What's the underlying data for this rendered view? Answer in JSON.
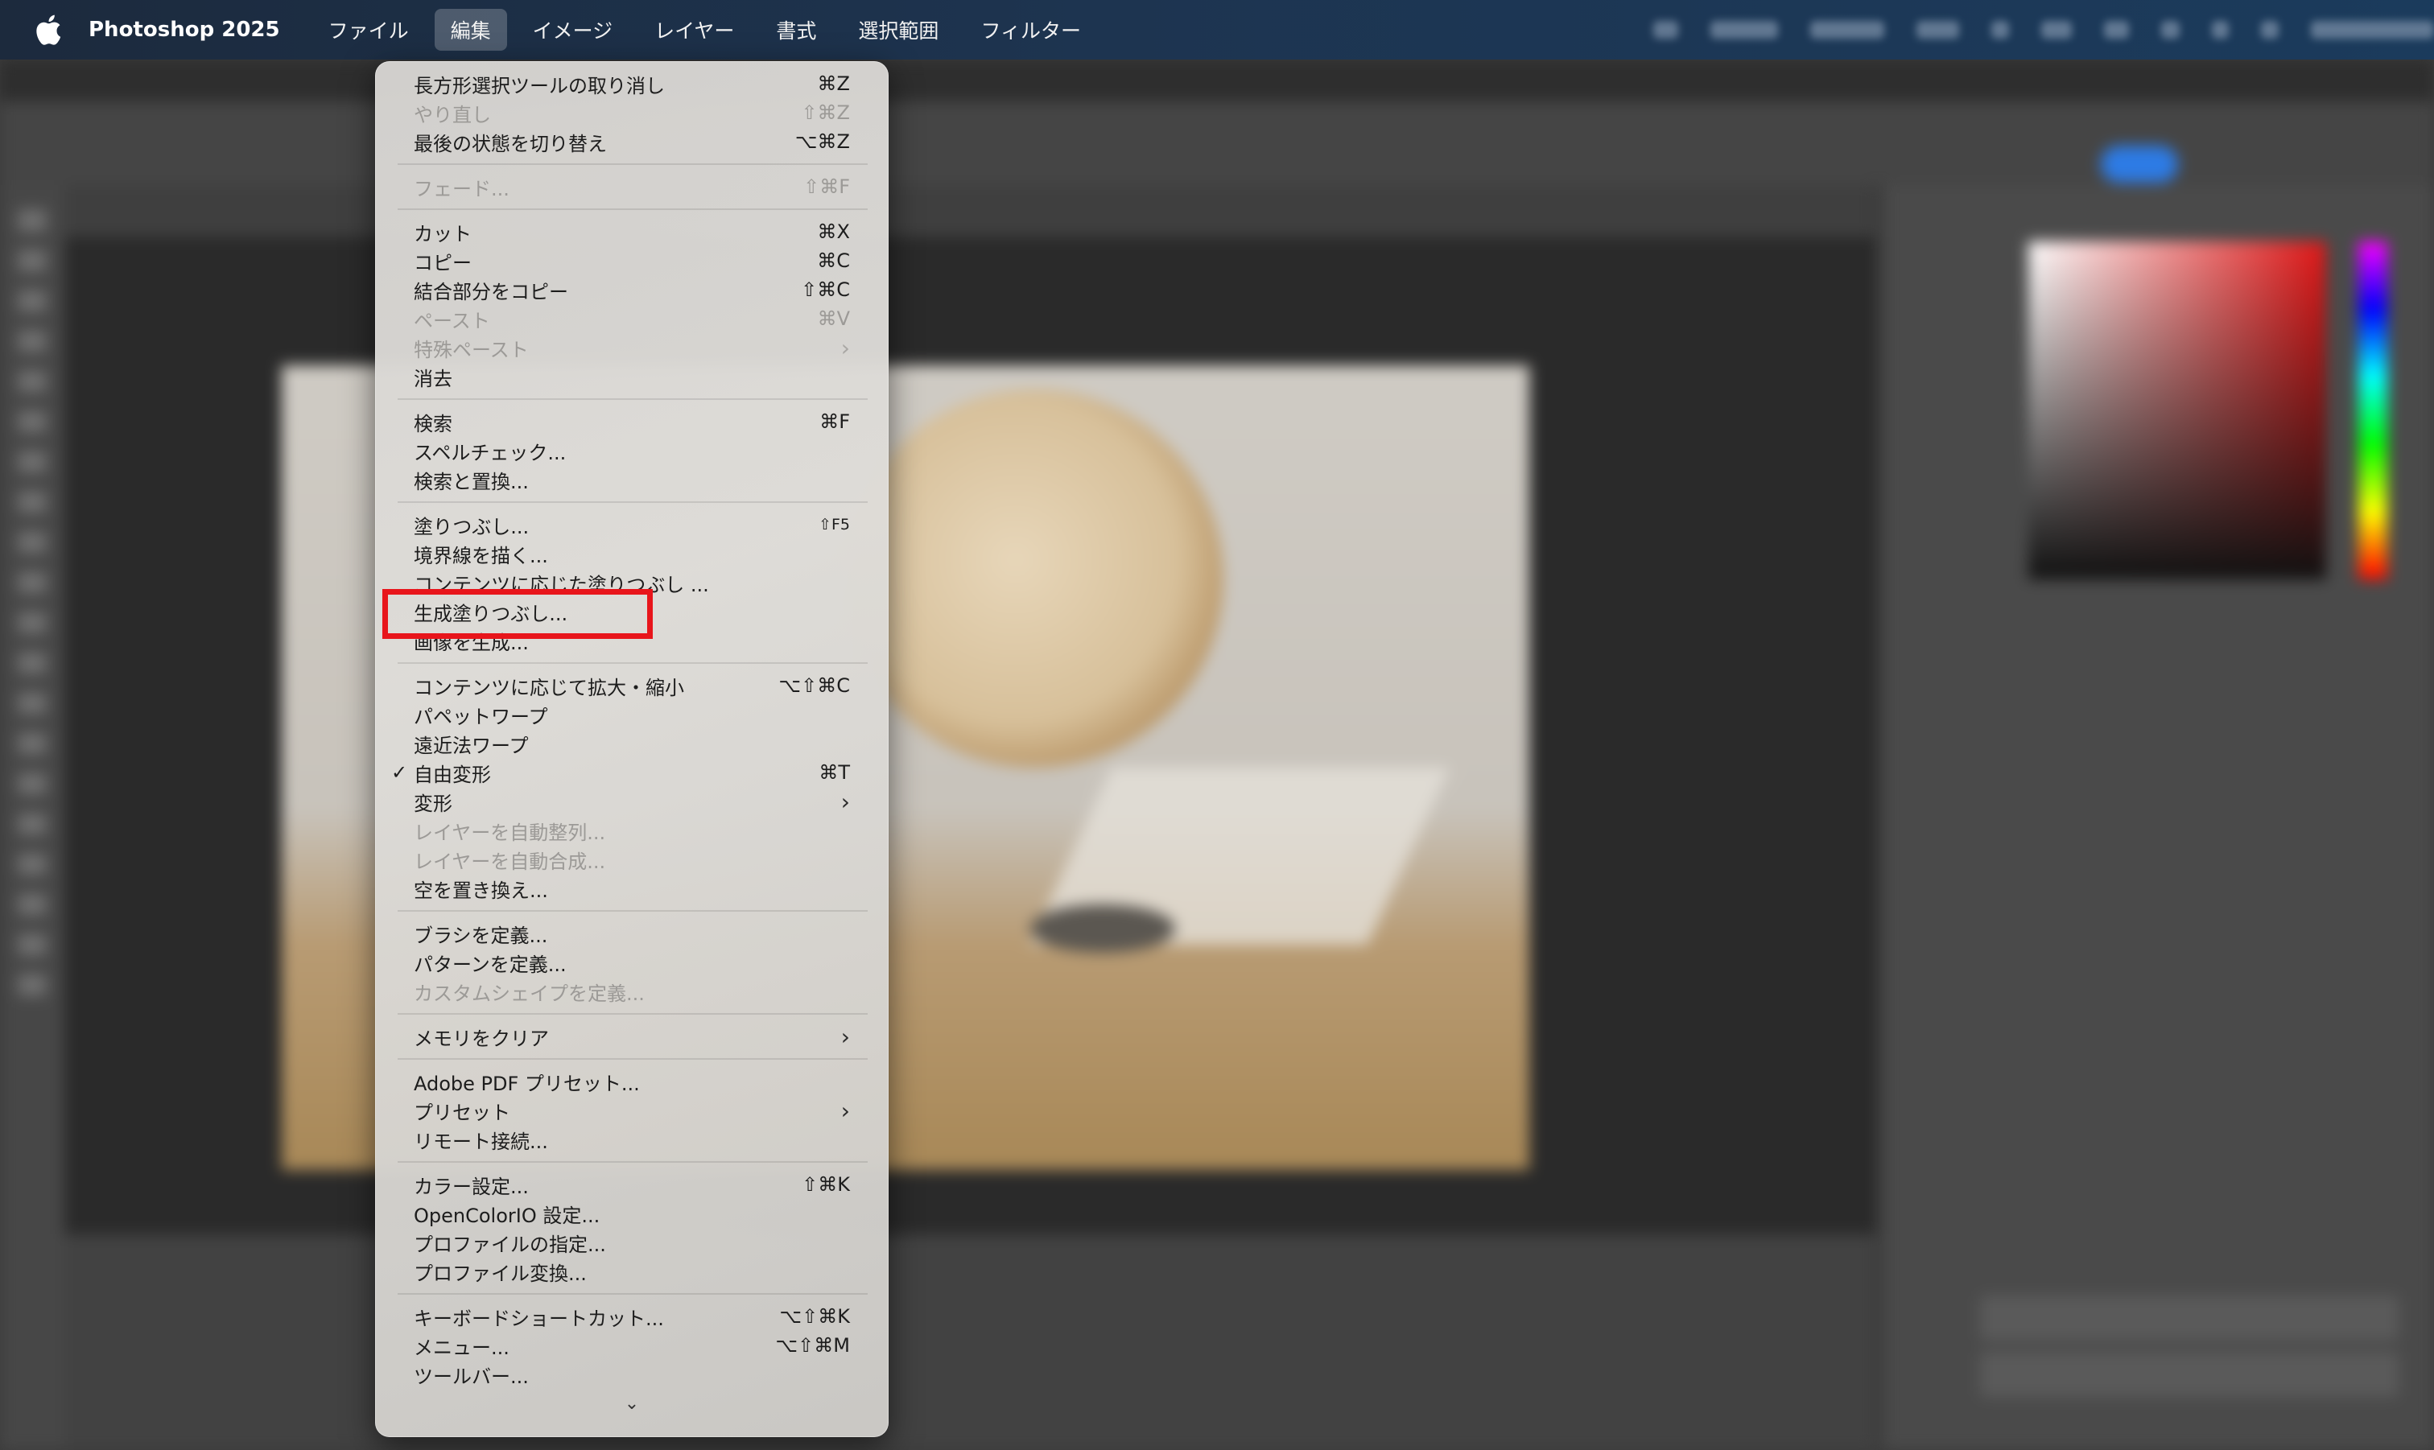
{
  "menubar": {
    "app_name": "Photoshop 2025",
    "menus": [
      {
        "label": "ファイル",
        "active": false
      },
      {
        "label": "編集",
        "active": true
      },
      {
        "label": "イメージ",
        "active": false
      },
      {
        "label": "レイヤー",
        "active": false
      },
      {
        "label": "書式",
        "active": false
      },
      {
        "label": "選択範囲",
        "active": false
      },
      {
        "label": "フィルター",
        "active": false
      }
    ]
  },
  "edit_menu": {
    "groups": [
      [
        {
          "label": "長方形選択ツールの取り消し",
          "shortcut": "⌘Z",
          "disabled": false
        },
        {
          "label": "やり直し",
          "shortcut": "⇧⌘Z",
          "disabled": true
        },
        {
          "label": "最後の状態を切り替え",
          "shortcut": "⌥⌘Z",
          "disabled": false
        }
      ],
      [
        {
          "label": "フェード...",
          "shortcut": "⇧⌘F",
          "disabled": true
        }
      ],
      [
        {
          "label": "カット",
          "shortcut": "⌘X",
          "disabled": false
        },
        {
          "label": "コピー",
          "shortcut": "⌘C",
          "disabled": false
        },
        {
          "label": "結合部分をコピー",
          "shortcut": "⇧⌘C",
          "disabled": false
        },
        {
          "label": "ペースト",
          "shortcut": "⌘V",
          "disabled": true
        },
        {
          "label": "特殊ペースト",
          "shortcut": "",
          "submenu": true,
          "disabled": true
        },
        {
          "label": "消去",
          "shortcut": "",
          "disabled": false
        }
      ],
      [
        {
          "label": "検索",
          "shortcut": "⌘F",
          "disabled": false
        },
        {
          "label": "スペルチェック...",
          "shortcut": "",
          "disabled": false
        },
        {
          "label": "検索と置換...",
          "shortcut": "",
          "disabled": false
        }
      ],
      [
        {
          "label": "塗りつぶし...",
          "shortcut": "⇧F5",
          "disabled": false,
          "small_shortcut": true
        },
        {
          "label": "境界線を描く...",
          "shortcut": "",
          "disabled": false
        },
        {
          "label": "コンテンツに応じた塗りつぶし ...",
          "shortcut": "",
          "disabled": false
        },
        {
          "label": "生成塗りつぶし...",
          "shortcut": "",
          "disabled": false
        },
        {
          "label": "画像を生成...",
          "shortcut": "",
          "disabled": false
        }
      ],
      [
        {
          "label": "コンテンツに応じて拡大・縮小",
          "shortcut": "⌥⇧⌘C",
          "disabled": false
        },
        {
          "label": "パペットワープ",
          "shortcut": "",
          "disabled": false
        },
        {
          "label": "遠近法ワープ",
          "shortcut": "",
          "disabled": false
        },
        {
          "label": "自由変形",
          "shortcut": "⌘T",
          "disabled": false,
          "checked": true
        },
        {
          "label": "変形",
          "shortcut": "",
          "submenu": true,
          "disabled": false
        },
        {
          "label": "レイヤーを自動整列...",
          "shortcut": "",
          "disabled": true
        },
        {
          "label": "レイヤーを自動合成...",
          "shortcut": "",
          "disabled": true
        },
        {
          "label": "空を置き換え...",
          "shortcut": "",
          "disabled": false
        }
      ],
      [
        {
          "label": "ブラシを定義...",
          "shortcut": "",
          "disabled": false
        },
        {
          "label": "パターンを定義...",
          "shortcut": "",
          "disabled": false
        },
        {
          "label": "カスタムシェイプを定義...",
          "shortcut": "",
          "disabled": true
        }
      ],
      [
        {
          "label": "メモリをクリア",
          "shortcut": "",
          "submenu": true,
          "disabled": false
        }
      ],
      [
        {
          "label": "Adobe PDF プリセット...",
          "shortcut": "",
          "disabled": false
        },
        {
          "label": "プリセット",
          "shortcut": "",
          "submenu": true,
          "disabled": false
        },
        {
          "label": "リモート接続...",
          "shortcut": "",
          "disabled": false
        }
      ],
      [
        {
          "label": "カラー設定...",
          "shortcut": "⇧⌘K",
          "disabled": false
        },
        {
          "label": "OpenColorIO 設定...",
          "shortcut": "",
          "disabled": false
        },
        {
          "label": "プロファイルの指定...",
          "shortcut": "",
          "disabled": false
        },
        {
          "label": "プロファイル変換...",
          "shortcut": "",
          "disabled": false
        }
      ],
      [
        {
          "label": "キーボードショートカット...",
          "shortcut": "⌥⇧⌘K",
          "disabled": false
        },
        {
          "label": "メニュー...",
          "shortcut": "⌥⇧⌘M",
          "disabled": false
        },
        {
          "label": "ツールバー...",
          "shortcut": "",
          "disabled": false
        }
      ]
    ],
    "more_indicator": "⌄"
  },
  "highlighted_item": "生成塗りつぶし...",
  "colors": {
    "highlight_box": "#e8151b",
    "menubar_bg": "#1d3450",
    "share_button": "#2d7be5"
  }
}
